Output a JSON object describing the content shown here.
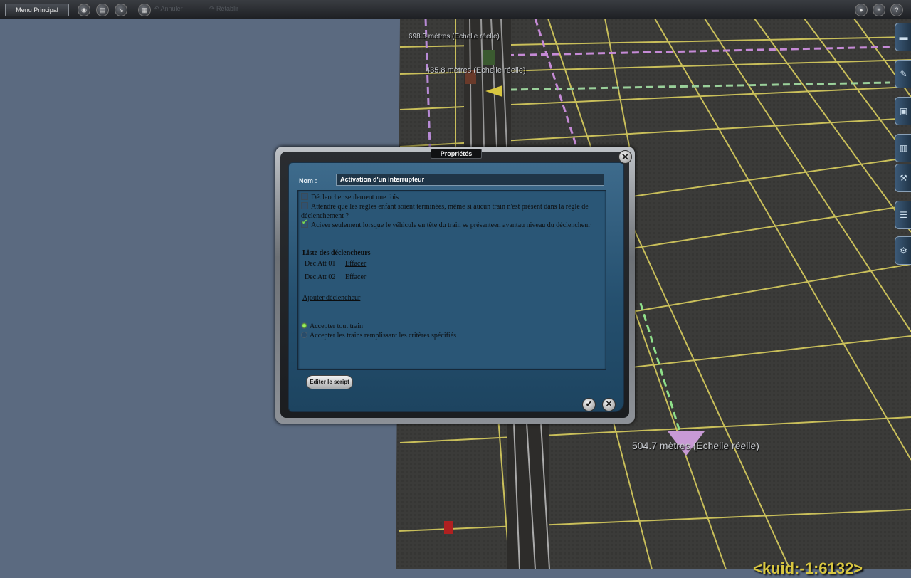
{
  "toolbar": {
    "menu_label": "Menu Principal",
    "icons": [
      "eye-icon",
      "trash-icon",
      "pipette-icon",
      "layers-icon"
    ],
    "undo_label": "Annuler",
    "redo_label": "Rétablir",
    "right_icons": [
      "search-icon",
      "plus-icon",
      "help-icon"
    ]
  },
  "scene": {
    "distance_labels": [
      "698.3 mètres  (Echelle réelle)",
      "435.8 mètres  (Echelle réelle)",
      "504.7 mètres  (Echelle réelle)"
    ],
    "kuid": "<kuid:-1:6132>"
  },
  "rail": {
    "tabs": [
      "terrain-icon",
      "paint-icon",
      "objects-icon",
      "track-icon",
      "tools-icon",
      "layers-icon",
      "settings-icon"
    ]
  },
  "dialog": {
    "title": "Propriétés",
    "name_label": "Nom :",
    "name_value": "Activation d'un interrupteur",
    "options": [
      {
        "label": "Déclencher seulement une fois",
        "checked": false
      },
      {
        "label": "Attendre que les règles enfant soient terminées, même si aucun train n'est présent dans la règle de déclenchement ?",
        "checked": false
      },
      {
        "label": "Aciver seulement lorsque le véhicule en tête du train se présenteen avantau niveau du déclencheur",
        "checked": true
      }
    ],
    "trigger_list_title": "Liste des déclencheurs",
    "triggers": [
      {
        "name": "Dec Att 01",
        "action": "Effacer"
      },
      {
        "name": "Dec Att 02",
        "action": "Effacer"
      }
    ],
    "add_trigger_label": "Ajouter déclencheur",
    "radio_options": [
      {
        "label": "Accepter tout train",
        "selected": true
      },
      {
        "label": "Accepter les trains remplissant les critères spécifiés",
        "selected": false
      }
    ],
    "script_button": "Editer le script",
    "ok_icon": "✔",
    "cancel_icon": "✕",
    "close_icon": "✕"
  },
  "colors": {
    "grid_line": "#c9bf5a",
    "panel_blue": "#2e5e80",
    "sky": "#5b6a80",
    "ground": "#3a3a38"
  }
}
